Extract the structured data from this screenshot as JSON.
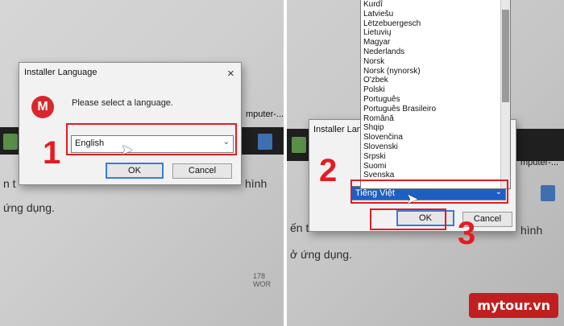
{
  "left": {
    "dialog": {
      "title": "Installer Language",
      "close": "×",
      "logo_letter": "M",
      "message": "Please select a language.",
      "selected_language": "English",
      "ok_label": "OK",
      "cancel_label": "Cancel"
    },
    "step_number": "1",
    "background": {
      "taskbar_text": "mputer-...",
      "doc_line_1": "n t",
      "doc_line_1_end": "hình",
      "doc_line_2": "ứng dụng.",
      "word_count": "178 WOR"
    }
  },
  "right": {
    "dialog": {
      "title": "Installer Langu",
      "selected_language": "Tiếng Việt",
      "ok_label": "OK",
      "cancel_label": "Cancel"
    },
    "languages": [
      "Kurdî",
      "Latviešu",
      "Lëtzebuergesch",
      "Lietuvių",
      "Magyar",
      "Nederlands",
      "Norsk",
      "Norsk (nynorsk)",
      "O'zbek",
      "Polski",
      "Português",
      "Português Brasileiro",
      "Română",
      "Shqip",
      "Slovenčina",
      "Slovenski",
      "Srpski",
      "Suomi",
      "Svenska"
    ],
    "step_numbers": [
      "2",
      "3"
    ],
    "background": {
      "taskbar_text": "mputer-...",
      "doc_line_1": "ến t",
      "doc_line_1_end": "hình",
      "doc_line_2": "ở ứng dụng."
    }
  },
  "brand": "mytour.vn",
  "colors": {
    "accent_red": "#e31b23",
    "selection_blue": "#1e5fc2",
    "brand_red": "#c11f1f"
  }
}
